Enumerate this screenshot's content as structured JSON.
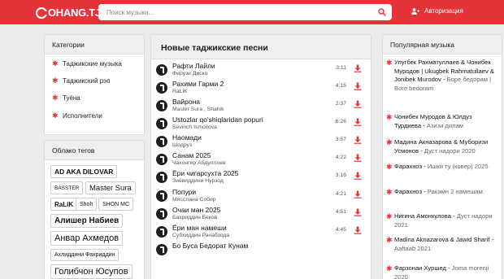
{
  "header": {
    "logo_text": "OHANG.TJ",
    "search_placeholder": "Поиск музыки...",
    "auth_label": "Авторизация"
  },
  "categories": {
    "title": "Категории",
    "items": [
      "Таджикские музыка",
      "Таджикский рэп",
      "Туёна",
      "Исполнители"
    ]
  },
  "tags": {
    "title": "Облако тегов",
    "items": [
      "AD AKA DILOVAR",
      "BASSTER",
      "Master Sura",
      "RaLiK",
      "Shoh",
      "SHON MC",
      "Алишер Набиев",
      "Анвар Ахмедов",
      "Ахлиддини Фахриддин",
      "Голибчон Юсупов"
    ]
  },
  "main": {
    "title": "Новые таджикские песни",
    "songs": [
      {
        "title": "Рафти Лайли",
        "artist": "Фирузи Диско",
        "duration": "3:11"
      },
      {
        "title": "Рахими Гарми 2",
        "artist": "RaLiK",
        "duration": "4:15"
      },
      {
        "title": "Вайрона",
        "artist": "Master Sura , Shahik",
        "duration": "2:37"
      },
      {
        "title": "Ustozlar qo'shiqlaridan popuri",
        "artist": "Sevinch Ismoilova",
        "duration": "6:26"
      },
      {
        "title": "Наомади",
        "artist": "Шодруз",
        "duration": "3:57"
      },
      {
        "title": "Санам 2025",
        "artist": "Чахонгир Абдуллоев",
        "duration": "4:22"
      },
      {
        "title": "Ёри чигарсухта 2025",
        "artist": "Зиёвиддини Нурзод",
        "duration": "3:16"
      },
      {
        "title": "Попури",
        "artist": "Мисслана Собир",
        "duration": "4:21"
      },
      {
        "title": "Очаи ман 2025",
        "artist": "Бахриддин Беков",
        "duration": "4:51"
      },
      {
        "title": "Ёри ман намеши",
        "artist": "Субхиддин Рачабзода",
        "duration": "4:45"
      },
      {
        "title": "Бо Буса Бедорат Кунам",
        "artist": "",
        "duration": ""
      }
    ]
  },
  "popular": {
    "title": "Популярная музыка",
    "items": [
      {
        "title": "Улугбек Рахматуллаев & Чонибек Муродов | Ukugbek Rahmatullaev & Jonibek Murodov -",
        "sub": "Боре бедорам | Bore bedoram"
      },
      {
        "title": "Чонибек Муродов & Юлдуз Турдиева -",
        "sub": "Азизи дилам"
      },
      {
        "title": "Мадина Акназарова & Муборизи Усмонов -",
        "sub": "Дуст надори 2020"
      },
      {
        "title": "Фарахноз -",
        "sub": "Ишки ту (ковер) 2025"
      },
      {
        "title": "Фарахноз -",
        "sub": "Ракамн 2 намешам"
      },
      {
        "title": "Нигина Амонкулова -",
        "sub": "Дуст надори 2021"
      },
      {
        "title": "Madina Aknazarova & Jawid Sharif -",
        "sub": "Aaftaab 2021"
      },
      {
        "title": "Фарзонаи Хуршед -",
        "sub": "Joma morenji 2020"
      }
    ]
  },
  "colors": {
    "accent": "#e4343a",
    "header_bg": "#e4343a",
    "page_bg": "#ececec"
  }
}
